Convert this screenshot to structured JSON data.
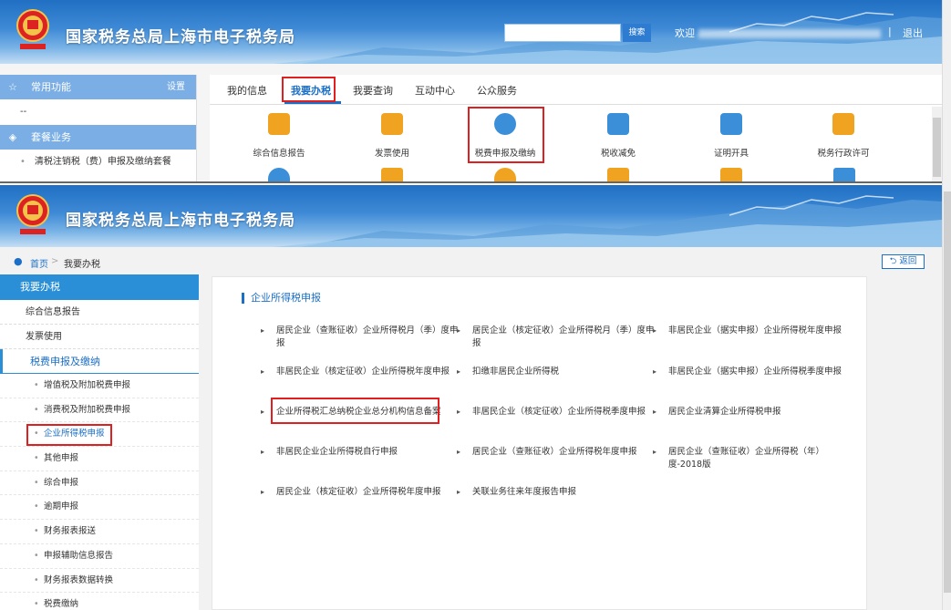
{
  "site_title": "国家税务总局上海市电子税务局",
  "header": {
    "search_placeholder": "",
    "search_button": "搜索",
    "welcome": "欢迎",
    "separator": "|",
    "logout": "退出"
  },
  "top_left": {
    "common_functions": "常用功能",
    "settings": "设置",
    "placeholder_row": "--",
    "package_services": "套餐业务",
    "package_item": "清税注销税（费）申报及缴纳套餐"
  },
  "top_tabs": [
    "我的信息",
    "我要办税",
    "我要查询",
    "互动中心",
    "公众服务"
  ],
  "services": [
    "综合信息报告",
    "发票使用",
    "税费申报及缴纳",
    "税收减免",
    "证明开具",
    "税务行政许可"
  ],
  "breadcrumb": {
    "home": "首页",
    "separator": ">",
    "current": "我要办税",
    "back_button": "返回"
  },
  "left_nav": {
    "header": "我要办税",
    "items": [
      "综合信息报告",
      "发票使用"
    ],
    "section": "税费申报及缴纳",
    "sub_items": [
      "增值税及附加税费申报",
      "消费税及附加税费申报",
      "企业所得税申报",
      "其他申报",
      "综合申报",
      "逾期申报",
      "财务报表报送",
      "申报辅助信息报告",
      "财务报表数据转换",
      "税费缴纳"
    ]
  },
  "main": {
    "section_title": "企业所得税申报",
    "items": [
      "居民企业（查账征收）企业所得税月（季）度申报",
      "居民企业（核定征收）企业所得税月（季）度申报",
      "非居民企业（据实申报）企业所得税年度申报",
      "非居民企业（核定征收）企业所得税年度申报",
      "扣缴非居民企业所得税",
      "非居民企业（据实申报）企业所得税季度申报",
      "企业所得税汇总纳税企业总分机构信息备案",
      "非居民企业（核定征收）企业所得税季度申报",
      "居民企业清算企业所得税申报",
      "非居民企业企业所得税自行申报",
      "居民企业（查账征收）企业所得税年度申报",
      "居民企业（查账征收）企业所得税（年）度-2018版",
      "居民企业（核定征收）企业所得税年度申报",
      "关联业务往来年度报告申报"
    ]
  },
  "colors": {
    "brand_blue": "#1b6fc7",
    "nav_blue": "#2b8fd8",
    "highlight_red": "#e02020"
  }
}
